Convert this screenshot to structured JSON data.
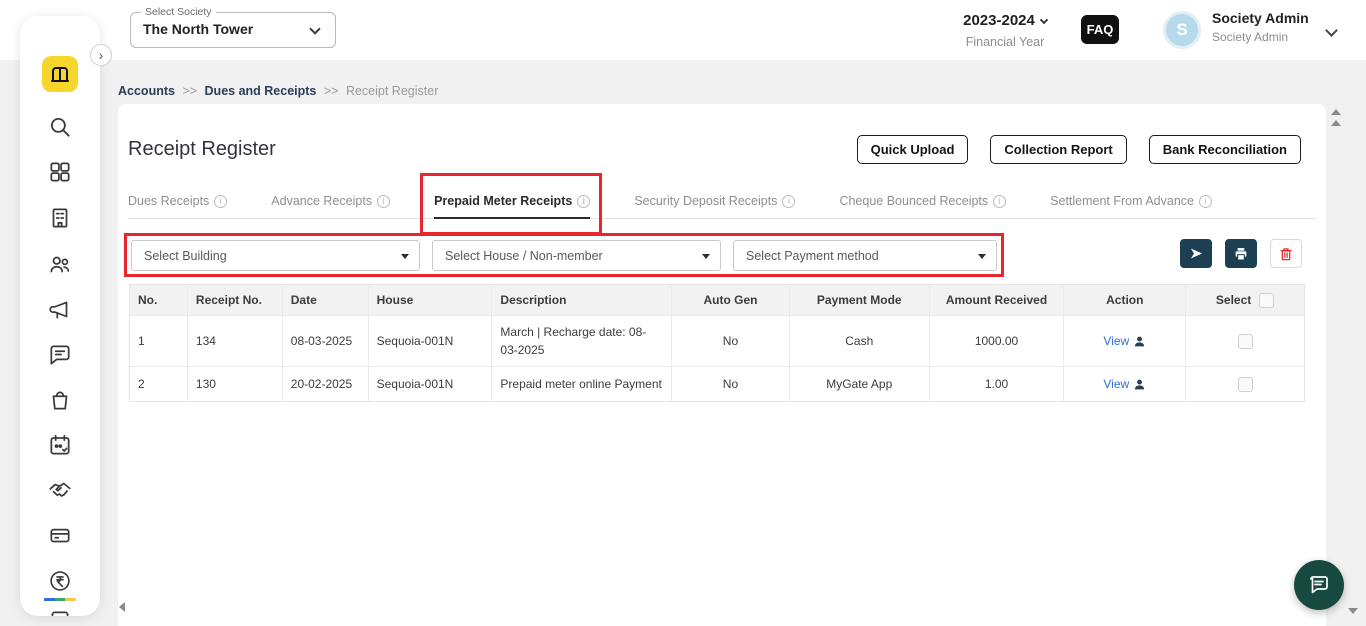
{
  "colors": {
    "accent_dark": "#1c3f53",
    "annotation_red": "#e8262d",
    "link_blue": "#2f6fd6",
    "fab_green": "#17493f",
    "logo_yellow": "#f6d62c",
    "avatar_blue": "#b7d9ec"
  },
  "header": {
    "society_label": "Select Society",
    "society_value": "The North Tower",
    "financial_year_value": "2023-2024",
    "financial_year_label": "Financial Year",
    "faq_label": "FAQ",
    "avatar_initial": "S",
    "user_name": "Society Admin",
    "user_role": "Society Admin"
  },
  "sidebar": {
    "icons": [
      "mygate-logo",
      "expand",
      "search",
      "dashboard",
      "building",
      "residents",
      "announcements",
      "messages",
      "services-bag",
      "attendance-calendar",
      "partnership-handshake",
      "wallet-card",
      "payments-rupee",
      "more"
    ]
  },
  "breadcrumb": {
    "items": [
      "Accounts",
      "Dues and Receipts",
      "Receipt Register"
    ],
    "separator": ">>"
  },
  "page": {
    "title": "Receipt Register",
    "buttons": [
      "Quick Upload",
      "Collection Report",
      "Bank Reconciliation"
    ]
  },
  "tabs": [
    {
      "label": "Dues Receipts"
    },
    {
      "label": "Advance Receipts"
    },
    {
      "label": "Prepaid Meter Receipts",
      "active": true
    },
    {
      "label": "Security Deposit Receipts"
    },
    {
      "label": "Cheque Bounced Receipts"
    },
    {
      "label": "Settlement From Advance"
    }
  ],
  "filters": {
    "building": "Select Building",
    "house": "Select House / Non-member",
    "payment": "Select Payment method"
  },
  "table": {
    "headers": [
      "No.",
      "Receipt No.",
      "Date",
      "House",
      "Description",
      "Auto Gen",
      "Payment Mode",
      "Amount Received",
      "Action",
      "Select"
    ],
    "rows": [
      {
        "no": "1",
        "receipt_no": "134",
        "date": "08-03-2025",
        "house": "Sequoia-001N",
        "description": "March | Recharge date: 08-03-2025",
        "auto_gen": "No",
        "payment_mode": "Cash",
        "amount": "1000.00",
        "action_label": "View"
      },
      {
        "no": "2",
        "receipt_no": "130",
        "date": "20-02-2025",
        "house": "Sequoia-001N",
        "description": "Prepaid meter online Payment",
        "auto_gen": "No",
        "payment_mode": "MyGate App",
        "amount": "1.00",
        "action_label": "View"
      }
    ]
  }
}
